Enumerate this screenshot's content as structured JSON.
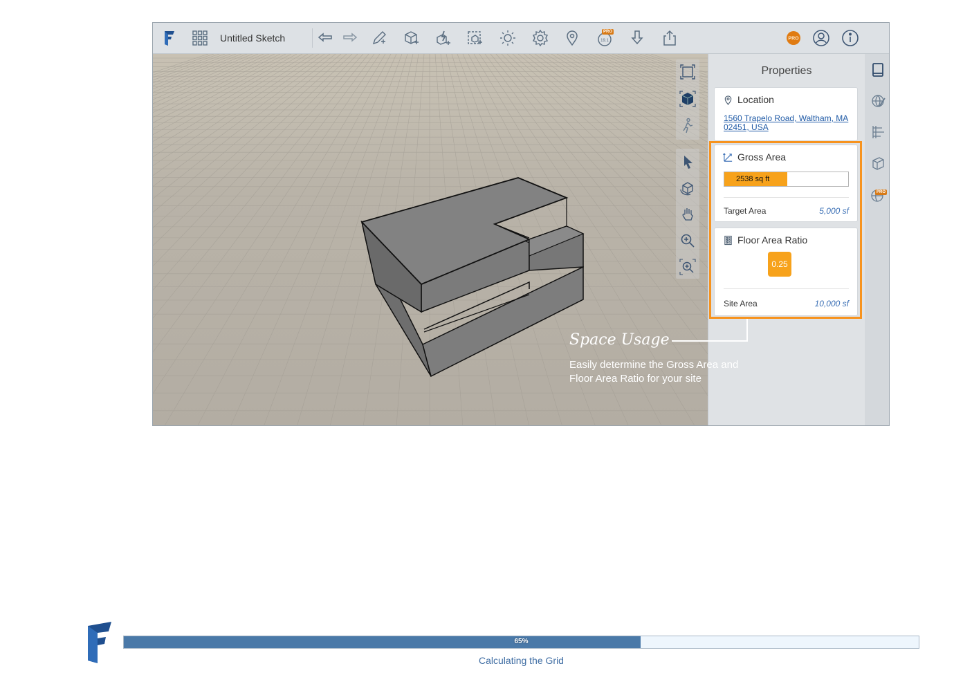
{
  "app": {
    "title": "Untitled Sketch",
    "toolbar": {
      "icons": [
        "formit-logo-icon",
        "grid-menu-icon",
        "undo-icon",
        "redo-icon",
        "sketch-pen-icon",
        "add-box-icon",
        "quick-tools-icon",
        "group-icon",
        "sun-icon",
        "settings-icon",
        "location-pin-icon",
        "timer-pro-icon",
        "download-icon",
        "share-icon",
        "pro-badge-icon",
        "user-icon",
        "info-icon"
      ],
      "pro_label": "PRO",
      "timer_label": "19.1"
    }
  },
  "properties": {
    "title": "Properties",
    "location": {
      "label": "Location",
      "address": "1560 Trapelo Road, Waltham, MA 02451, USA"
    },
    "gross_area": {
      "label": "Gross Area",
      "value_text": "2538 sq ft",
      "progress_fraction": 0.5076,
      "target_label": "Target Area",
      "target_value": "5,000 sf"
    },
    "floor_area_ratio": {
      "label": "Floor Area Ratio",
      "value": "0.25",
      "site_label": "Site Area",
      "site_value": "10,000 sf"
    }
  },
  "callout": {
    "title": "Space Usage",
    "description": "Easily determine the Gross Area and Floor Area Ratio for your site"
  },
  "loader": {
    "progress_percent": 65,
    "progress_text": "65%",
    "status": "Calculating the Grid"
  },
  "colors": {
    "accent_orange": "#f7931e",
    "bar_orange": "#f7a21b",
    "progress_blue": "#4a79a8",
    "link_blue": "#1f5aa6"
  }
}
